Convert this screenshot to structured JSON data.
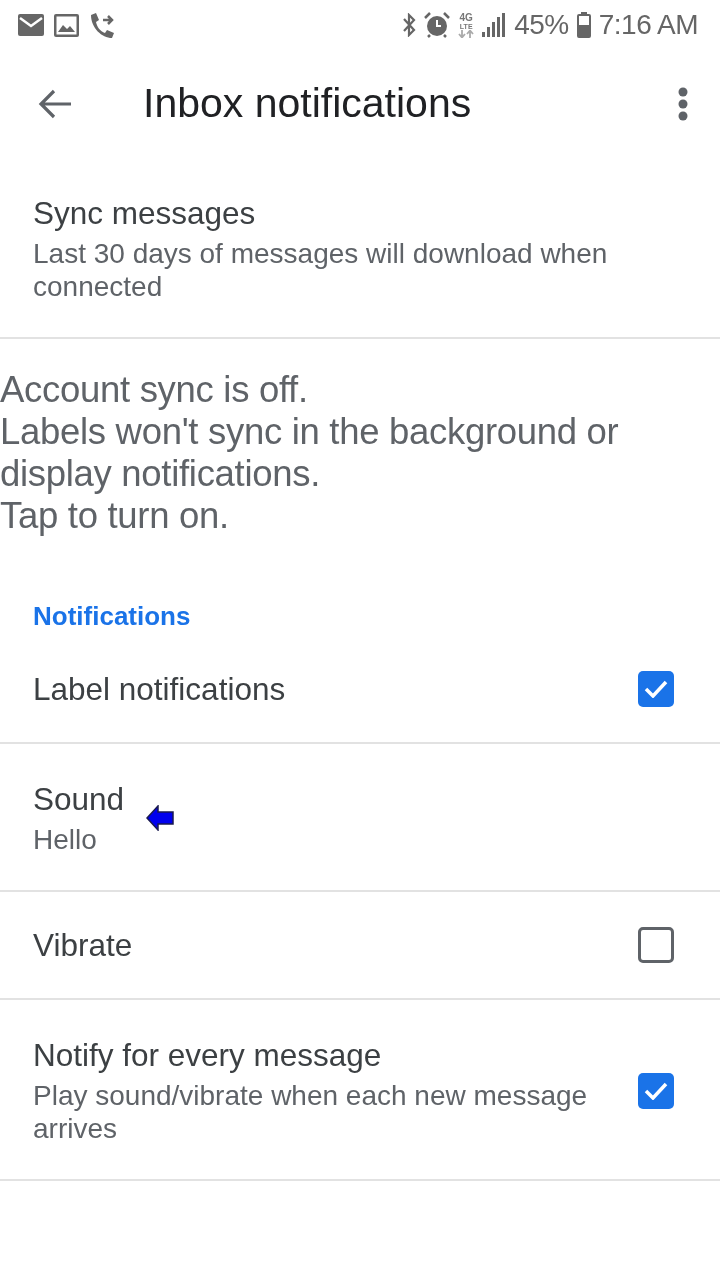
{
  "status_bar": {
    "network": [
      "4G",
      "LTE"
    ],
    "battery": "45%",
    "time": "7:16 AM"
  },
  "app_bar": {
    "title": "Inbox notifications"
  },
  "sync": {
    "title": "Sync messages",
    "subtitle": "Last 30 days of messages will download when connected"
  },
  "sync_banner": {
    "message": "Account sync is off.\nLabels won't sync in the background or display notifications.\nTap to turn on."
  },
  "section": {
    "title": "Notifications"
  },
  "settings": [
    {
      "kind": "checkbox",
      "title": "Label notifications",
      "checked": true
    },
    {
      "kind": "detail",
      "title": "Sound",
      "subtitle": "Hello",
      "pointer": true
    },
    {
      "kind": "checkbox",
      "title": "Vibrate",
      "checked": false
    },
    {
      "kind": "checkbox",
      "title": "Notify for every message",
      "subtitle": "Play sound/vibrate when each new message arrives",
      "checked": true
    }
  ]
}
